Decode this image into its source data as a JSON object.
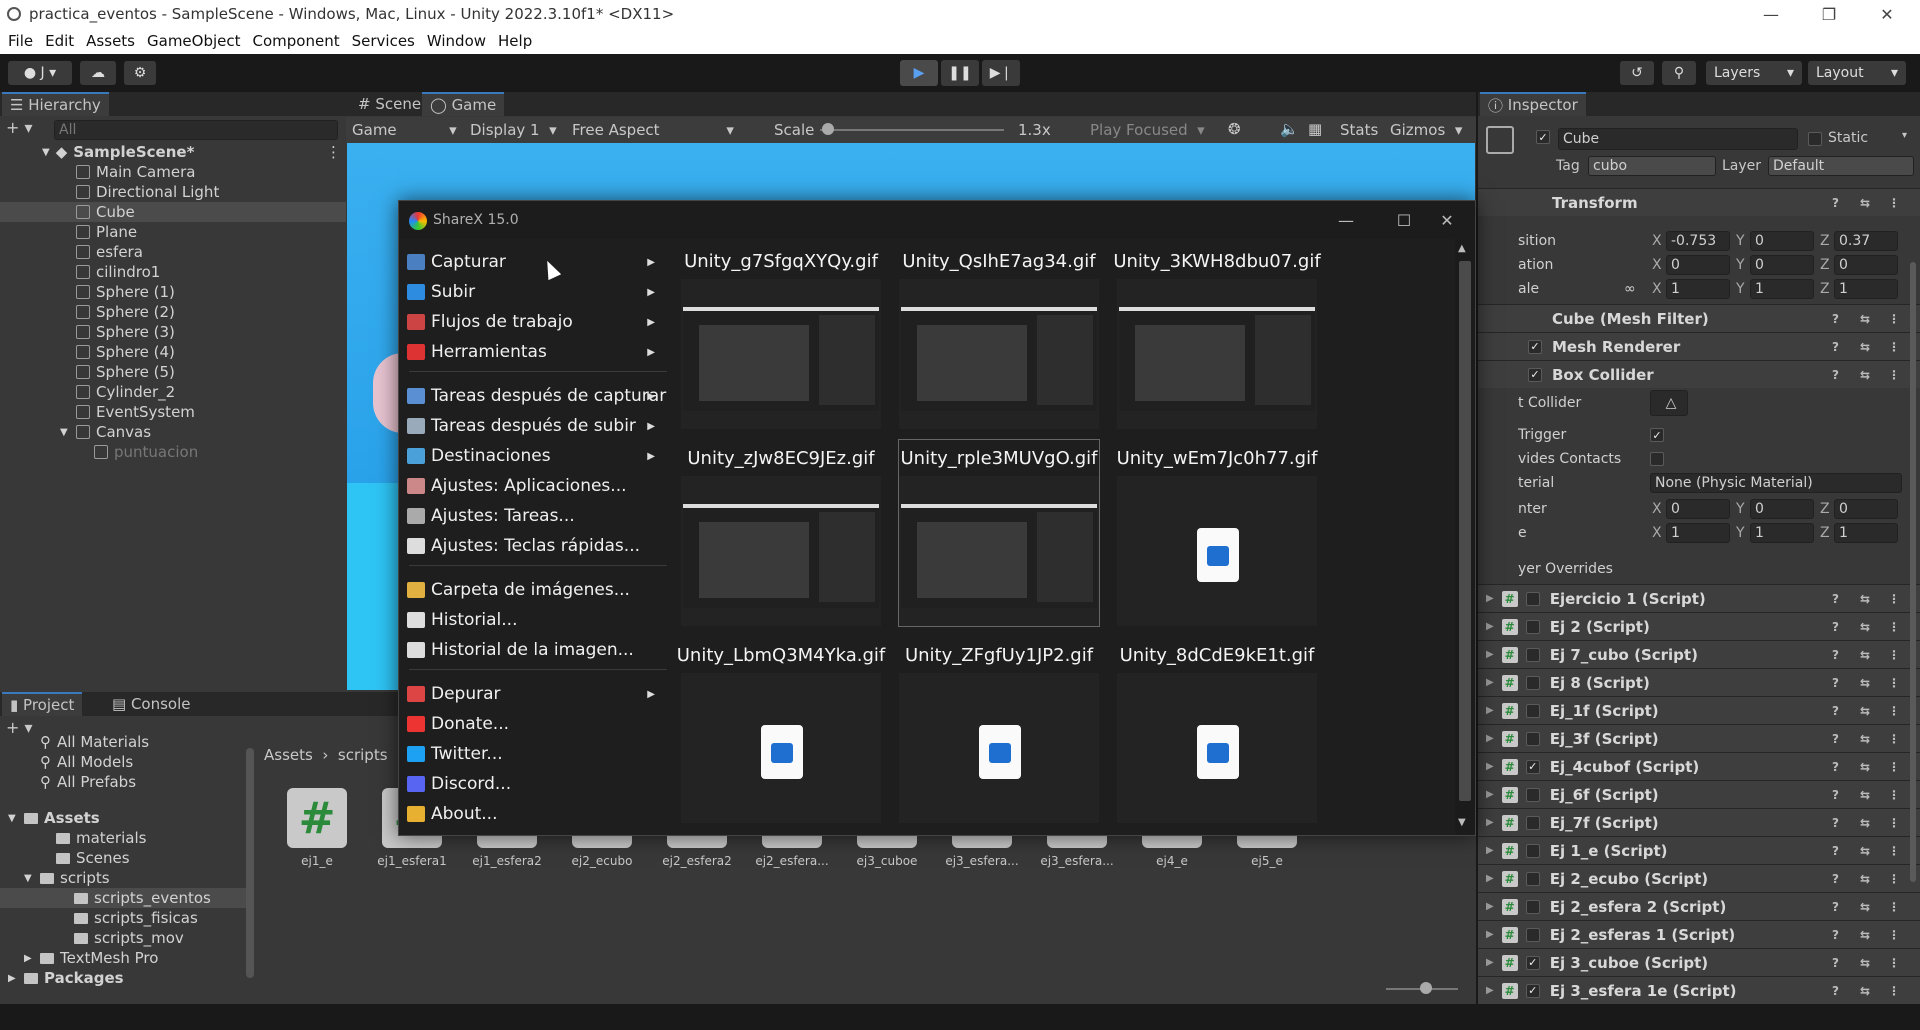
{
  "window": {
    "title": "practica_eventos - SampleScene - Windows, Mac, Linux - Unity 2022.3.10f1* <DX11>",
    "menus": [
      "File",
      "Edit",
      "Assets",
      "GameObject",
      "Component",
      "Services",
      "Window",
      "Help"
    ]
  },
  "toolbar": {
    "account": "J",
    "layers_label": "Layers",
    "layout_label": "Layout"
  },
  "hierarchy": {
    "tab": "Hierarchy",
    "search_placeholder": "All",
    "scene": "SampleScene*",
    "items": [
      "Main Camera",
      "Directional Light",
      "Cube",
      "Plane",
      "esfera",
      "cilindro1",
      "Sphere (1)",
      "Sphere (2)",
      "Sphere (3)",
      "Sphere (4)",
      "Sphere (5)",
      "Cylinder_2",
      "EventSystem",
      "Canvas",
      "puntuacion"
    ]
  },
  "gameview": {
    "tab_scene": "Scene",
    "tab_game": "Game",
    "mode": "Game",
    "display": "Display 1",
    "aspect": "Free Aspect",
    "scale_label": "Scale",
    "scale_value": "1.3x",
    "play_focused": "Play Focused",
    "stats": "Stats",
    "gizmos": "Gizmos"
  },
  "inspector": {
    "tab": "Inspector",
    "object_name": "Cube",
    "static_label": "Static",
    "tag_label": "Tag",
    "tag_value": "cubo",
    "layer_label": "Layer",
    "layer_value": "Default",
    "transform": "Transform",
    "position_label": "sition",
    "rotation_label": "ation",
    "scale_label": "ale",
    "position": {
      "x": "-0.753",
      "y": "0",
      "z": "0.37"
    },
    "rotation": {
      "x": "0",
      "y": "0",
      "z": "0"
    },
    "scale": {
      "x": "1",
      "y": "1",
      "z": "1"
    },
    "mesh_filter": "Cube (Mesh Filter)",
    "mesh_renderer": "Mesh Renderer",
    "box_collider": "Box Collider",
    "edit_collider": "t Collider",
    "is_trigger": "Trigger",
    "provides_contacts": "vides Contacts",
    "material_label": "terial",
    "material_value": "None (Physic Material)",
    "center_label": "nter",
    "center": {
      "x": "0",
      "y": "0",
      "z": "0"
    },
    "size_label": "e",
    "size": {
      "x": "1",
      "y": "1",
      "z": "1"
    },
    "layer_overrides": "yer Overrides",
    "scripts": [
      {
        "name": "Ejercicio 1 (Script)",
        "checked": false
      },
      {
        "name": "Ej 2 (Script)",
        "checked": false
      },
      {
        "name": "Ej 7_cubo (Script)",
        "checked": false
      },
      {
        "name": "Ej 8 (Script)",
        "checked": false
      },
      {
        "name": "Ej_1f (Script)",
        "checked": false
      },
      {
        "name": "Ej_3f (Script)",
        "checked": false
      },
      {
        "name": "Ej_4cubof (Script)",
        "checked": true
      },
      {
        "name": "Ej_6f (Script)",
        "checked": false
      },
      {
        "name": "Ej_7f (Script)",
        "checked": false
      },
      {
        "name": "Ej 1_e (Script)",
        "checked": false
      },
      {
        "name": "Ej 2_ecubo (Script)",
        "checked": false
      },
      {
        "name": "Ej 2_esfera 2 (Script)",
        "checked": false
      },
      {
        "name": "Ej 2_esferas 1 (Script)",
        "checked": false
      },
      {
        "name": "Ej 3_cuboe (Script)",
        "checked": true
      },
      {
        "name": "Ej 3_esfera 1e (Script)",
        "checked": true
      }
    ]
  },
  "project": {
    "tab_project": "Project",
    "tab_console": "Console",
    "favorites": [
      "All Materials",
      "All Models",
      "All Prefabs"
    ],
    "tree": [
      "Assets",
      "materials",
      "Scenes",
      "scripts",
      "scripts_eventos",
      "scripts_fisicas",
      "scripts_mov",
      "TextMesh Pro",
      "Packages"
    ],
    "breadcrumb": [
      "Assets",
      "scripts"
    ],
    "assets": [
      "ej1_e",
      "ej1_esfera1",
      "ej1_esfera2",
      "ej2_ecubo",
      "ej2_esfera2",
      "ej2_esfera...",
      "ej3_cuboe",
      "ej3_esfera...",
      "ej3_esfera...",
      "ej4_e",
      "ej5_e"
    ]
  },
  "sharex": {
    "title": "ShareX 15.0",
    "menu": [
      {
        "label": "Capturar",
        "sub": true,
        "color": "#4a7fc1"
      },
      {
        "label": "Subir",
        "sub": true,
        "color": "#2d8be0"
      },
      {
        "label": "Flujos de trabajo",
        "sub": true,
        "color": "#c44"
      },
      {
        "label": "Herramientas",
        "sub": true,
        "color": "#d33"
      },
      {
        "label": "Tareas después de capturar",
        "sub": true,
        "color": "#5b8fd4"
      },
      {
        "label": "Tareas después de subir",
        "sub": true,
        "color": "#9ab"
      },
      {
        "label": "Destinaciones",
        "sub": true,
        "color": "#4aa0d8"
      },
      {
        "label": "Ajustes: Aplicaciones...",
        "sub": false,
        "color": "#c88"
      },
      {
        "label": "Ajustes: Tareas...",
        "sub": false,
        "color": "#aaa"
      },
      {
        "label": "Ajustes: Teclas rápidas...",
        "sub": false,
        "color": "#ddd"
      },
      {
        "label": "Carpeta de imágenes...",
        "sub": false,
        "color": "#e0b040"
      },
      {
        "label": "Historial...",
        "sub": false,
        "color": "#ddd"
      },
      {
        "label": "Historial de la imagen...",
        "sub": false,
        "color": "#ddd"
      },
      {
        "label": "Depurar",
        "sub": true,
        "color": "#d44"
      },
      {
        "label": "Donate...",
        "sub": false,
        "color": "#e33"
      },
      {
        "label": "Twitter...",
        "sub": false,
        "color": "#1da1f2"
      },
      {
        "label": "Discord...",
        "sub": false,
        "color": "#5865f2"
      },
      {
        "label": "About...",
        "sub": false,
        "color": "#e8b030"
      }
    ],
    "files": [
      {
        "name": "Unity_g7SfgqXYQy.gif",
        "preview": true
      },
      {
        "name": "Unity_QsIhE7ag34.gif",
        "preview": true
      },
      {
        "name": "Unity_3KWH8dbu07.gif",
        "preview": true
      },
      {
        "name": "Unity_zJw8EC9JEz.gif",
        "preview": true
      },
      {
        "name": "Unity_rple3MUVgO.gif",
        "preview": true
      },
      {
        "name": "Unity_wEm7Jc0h77.gif",
        "preview": false
      },
      {
        "name": "Unity_LbmQ3M4Yka.gif",
        "preview": false
      },
      {
        "name": "Unity_ZFgfUy1JP2.gif",
        "preview": false
      },
      {
        "name": "Unity_8dCdE9kE1t.gif",
        "preview": false
      }
    ]
  }
}
